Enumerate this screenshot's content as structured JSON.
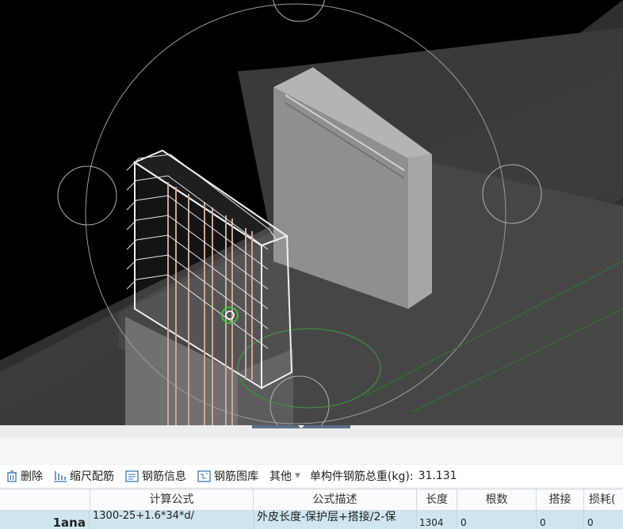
{
  "toolbar": {
    "delete_label": "删除",
    "scale_rebar_label": "缩尺配筋",
    "rebar_info_label": "钢筋信息",
    "rebar_library_label": "钢筋图库",
    "other_label": "其他",
    "total_weight_label": "单构件钢筋总重(kg):",
    "total_weight_value": "31.131"
  },
  "table": {
    "headers": {
      "formula": "计算公式",
      "description": "公式描述",
      "length": "长度",
      "count": "根数",
      "lap": "搭接",
      "loss": "损耗("
    },
    "row": {
      "bar_code": "1ana",
      "formula": "1300-25+1.6*34*d/",
      "description": "外皮长度-保护层+搭接/2-保",
      "length": "1304",
      "count": "0",
      "lap": "0",
      "loss": "0"
    }
  },
  "colors": {
    "viewport_bg": "#000000",
    "selected_row": "#cfe6ef",
    "icon_blue": "#2d6db5"
  },
  "icons": [
    "trash-icon",
    "scale-bars-icon",
    "info-list-icon",
    "library-icon",
    "caret-down-icon"
  ]
}
